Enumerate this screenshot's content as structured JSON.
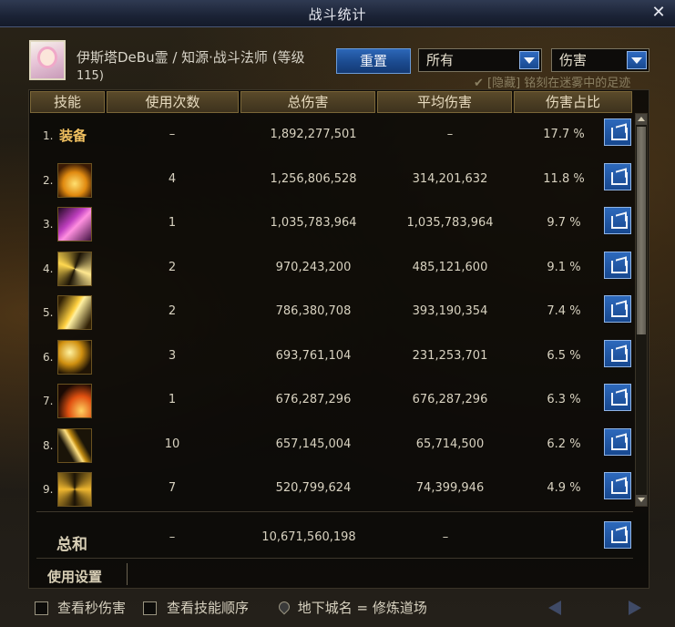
{
  "window": {
    "title": "战斗统计",
    "close_glyph": "✕"
  },
  "character": {
    "name": "伊斯塔DeBu霊 / 知源·战斗法师 (等级",
    "level": "115)"
  },
  "controls": {
    "reset_label": "重置",
    "filter_value": "所有",
    "type_value": "伤害",
    "hidden_note": "✔ [隐藏] 铭刻在迷雾中的足迹"
  },
  "columns": {
    "skill": "技能",
    "count": "使用次数",
    "total": "总伤害",
    "average": "平均伤害",
    "ratio": "伤害占比"
  },
  "rows": [
    {
      "num": "1.",
      "skill": "装备",
      "icon": "equipment-text",
      "count": "–",
      "total": "1,892,277,501",
      "average": "–",
      "ratio": "17.7 %"
    },
    {
      "num": "2.",
      "skill": "skill-2",
      "icon": "flame-burst-icon",
      "count": "4",
      "total": "1,256,806,528",
      "average": "314,201,632",
      "ratio": "11.8 %"
    },
    {
      "num": "3.",
      "skill": "skill-3",
      "icon": "purple-strike-icon",
      "count": "1",
      "total": "1,035,783,964",
      "average": "1,035,783,964",
      "ratio": "9.7 %"
    },
    {
      "num": "4.",
      "skill": "skill-4",
      "icon": "light-rays-icon",
      "count": "2",
      "total": "970,243,200",
      "average": "485,121,600",
      "ratio": "9.1 %"
    },
    {
      "num": "5.",
      "skill": "skill-5",
      "icon": "lightning-slash-icon",
      "count": "2",
      "total": "786,380,708",
      "average": "393,190,354",
      "ratio": "7.4 %"
    },
    {
      "num": "6.",
      "skill": "skill-6",
      "icon": "staff-sparks-icon",
      "count": "3",
      "total": "693,761,104",
      "average": "231,253,701",
      "ratio": "6.5 %"
    },
    {
      "num": "7.",
      "skill": "skill-7",
      "icon": "crescent-sweep-icon",
      "count": "1",
      "total": "676,287,296",
      "average": "676,287,296",
      "ratio": "6.3 %"
    },
    {
      "num": "8.",
      "skill": "skill-8",
      "icon": "golden-staff-icon",
      "count": "10",
      "total": "657,145,004",
      "average": "65,714,500",
      "ratio": "6.2 %"
    },
    {
      "num": "9.",
      "skill": "skill-9",
      "icon": "whirlwind-icon",
      "count": "7",
      "total": "520,799,624",
      "average": "74,399,946",
      "ratio": "4.9 %"
    }
  ],
  "summary": {
    "label": "总和",
    "count": "–",
    "total": "10,671,560,198",
    "average": "–"
  },
  "footer": {
    "usage_settings": "使用设置",
    "view_dps": "查看秒伤害",
    "view_order": "查看技能顺序",
    "dungeon": "地下城名 = 修炼道场"
  },
  "colors": {
    "accent_blue": "#1b4a8f",
    "header_gold": "#5a4a2a",
    "equip_gold": "#f0c060"
  }
}
